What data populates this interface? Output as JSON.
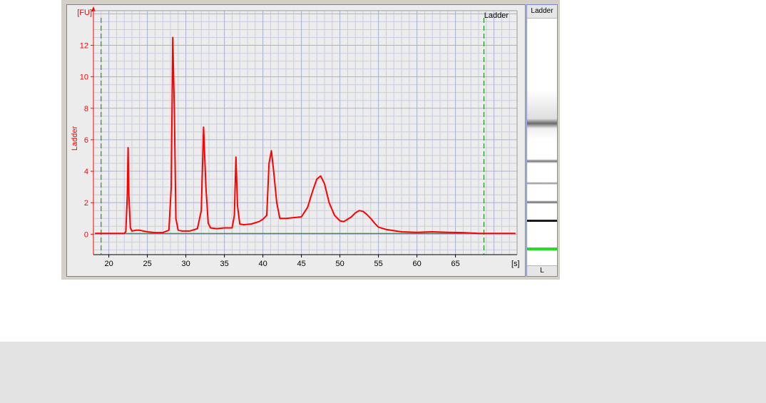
{
  "chart_data": {
    "type": "line",
    "title": "Ladder",
    "ylabel": "Ladder",
    "y_unit_label": "[FU]",
    "x_unit_label": "[s]",
    "xlim": [
      18,
      73
    ],
    "ylim": [
      -1.3,
      14.2
    ],
    "x_ticks": [
      "20",
      "25",
      "30",
      "35",
      "40",
      "45",
      "50",
      "55",
      "60",
      "65"
    ],
    "y_ticks": [
      "0",
      "2",
      "4",
      "6",
      "8",
      "10",
      "12"
    ],
    "grid": true,
    "markers": [
      19.0,
      68.7
    ],
    "baseline": 0.05,
    "trace_color": "#ff0000",
    "baseline_color": "#008000",
    "marker_color": "#008000",
    "series": [
      {
        "x": [
          18.2,
          20,
          22,
          22.2,
          22.4,
          22.5,
          22.6,
          22.8,
          23.0,
          23.5,
          24.0,
          25.0,
          26.0,
          27.0,
          27.8,
          28.1,
          28.3,
          28.5,
          28.7,
          29.0,
          29.5,
          30.5,
          31.5,
          32.0,
          32.3,
          32.6,
          32.9,
          33.2,
          34.0,
          35.0,
          36.0,
          36.3,
          36.5,
          36.7,
          37.0,
          37.5,
          38.5,
          39.5,
          40.0,
          40.5,
          40.8,
          41.1,
          41.4,
          41.8,
          42.2,
          43.0,
          44.0,
          45.0,
          45.8,
          46.5,
          47.0,
          47.5,
          48.0,
          48.6,
          49.3,
          50.0,
          50.5,
          51.0,
          51.5,
          52.0,
          52.5,
          53.0,
          53.5,
          54.0,
          54.5,
          55.0,
          56.0,
          58.0,
          60.0,
          62.0,
          64.0,
          66.0,
          68.0,
          70.0,
          72.8
        ],
        "y": [
          0.05,
          0.05,
          0.05,
          0.15,
          2.5,
          5.5,
          2.5,
          0.4,
          0.2,
          0.25,
          0.25,
          0.15,
          0.1,
          0.1,
          0.25,
          3.0,
          12.5,
          8.0,
          1.0,
          0.25,
          0.2,
          0.2,
          0.35,
          1.5,
          6.8,
          3.0,
          0.7,
          0.4,
          0.35,
          0.4,
          0.4,
          1.2,
          4.9,
          1.8,
          0.65,
          0.6,
          0.65,
          0.8,
          0.95,
          1.2,
          4.5,
          5.3,
          4.0,
          2.0,
          1.0,
          1.0,
          1.05,
          1.1,
          1.7,
          2.8,
          3.5,
          3.7,
          3.2,
          2.0,
          1.2,
          0.85,
          0.8,
          0.95,
          1.1,
          1.35,
          1.5,
          1.45,
          1.25,
          1.0,
          0.7,
          0.45,
          0.3,
          0.15,
          0.12,
          0.15,
          0.12,
          0.1,
          0.05,
          0.05,
          0.05
        ]
      }
    ]
  },
  "gel": {
    "header": "Ladder",
    "footer": "L",
    "marker_color": "#22dd22"
  }
}
